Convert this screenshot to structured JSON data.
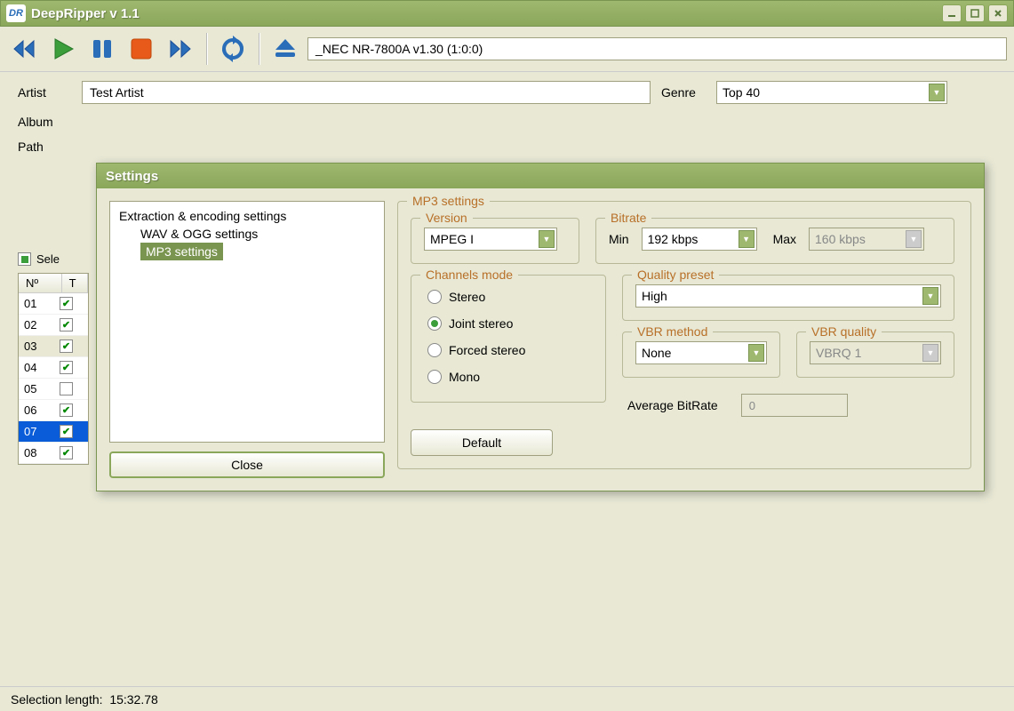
{
  "app": {
    "title": "DeepRipper v 1.1",
    "icon_text": "DR"
  },
  "toolbar": {
    "drive": "_NEC NR-7800A v1.30 (1:0:0)"
  },
  "form": {
    "artist_label": "Artist",
    "artist_value": "Test Artist",
    "genre_label": "Genre",
    "genre_value": "Top 40",
    "album_label": "Album",
    "path_label": "Path",
    "select_label": "Sele"
  },
  "table": {
    "col_num": "Nº",
    "col_t": "T",
    "rows": [
      {
        "num": "01",
        "checked": true,
        "selected": false
      },
      {
        "num": "02",
        "checked": true,
        "selected": false
      },
      {
        "num": "03",
        "checked": true,
        "selected": false,
        "hover": true
      },
      {
        "num": "04",
        "checked": true,
        "selected": false
      },
      {
        "num": "05",
        "checked": false,
        "selected": false
      },
      {
        "num": "06",
        "checked": true,
        "selected": false
      },
      {
        "num": "07",
        "checked": true,
        "selected": true
      },
      {
        "num": "08",
        "checked": true,
        "selected": false
      }
    ]
  },
  "status": {
    "selection_length_label": "Selection length:",
    "selection_length_value": "15:32.78"
  },
  "dialog": {
    "title": "Settings",
    "tree": {
      "root": "Extraction & encoding settings",
      "child1": "WAV & OGG settings",
      "child2": "MP3 settings"
    },
    "close": "Close",
    "mp3_legend": "MP3 settings",
    "version": {
      "legend": "Version",
      "value": "MPEG I"
    },
    "bitrate": {
      "legend": "Bitrate",
      "min_label": "Min",
      "min_value": "192 kbps",
      "max_label": "Max",
      "max_value": "160 kbps"
    },
    "channels": {
      "legend": "Channels mode",
      "stereo": "Stereo",
      "joint": "Joint stereo",
      "forced": "Forced stereo",
      "mono": "Mono"
    },
    "quality": {
      "legend": "Quality preset",
      "value": "High"
    },
    "vbr_method": {
      "legend": "VBR method",
      "value": "None"
    },
    "vbr_quality": {
      "legend": "VBR quality",
      "value": "VBRQ 1"
    },
    "avg_bitrate_label": "Average BitRate",
    "avg_bitrate_value": "0",
    "default_btn": "Default"
  }
}
